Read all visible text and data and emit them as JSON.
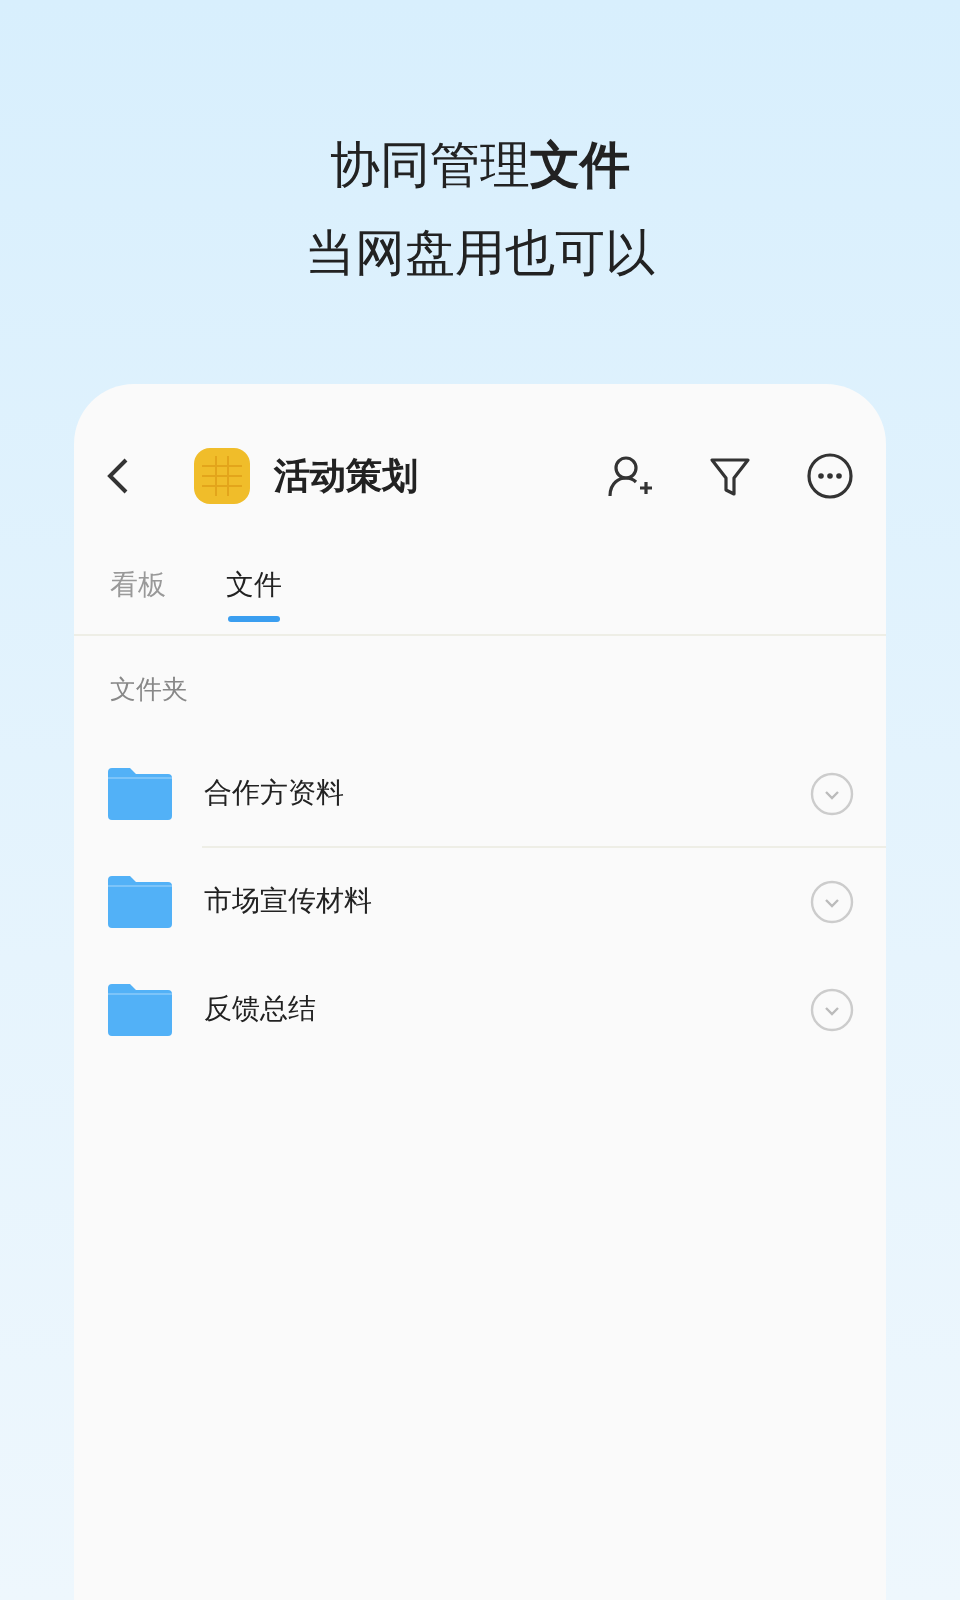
{
  "headline": {
    "line_1": "协同管理**文件**",
    "line_2": "当网盘用也可以"
  },
  "header": {
    "title": "活动策划"
  },
  "tabs": [
    {
      "label": "看板",
      "selected": false
    },
    {
      "label": "文件",
      "selected": true
    }
  ],
  "section_label": "文件夹",
  "folders": [
    {
      "name": "合作方资料",
      "divider": true
    },
    {
      "name": "市场宣传材料",
      "divider": false
    },
    {
      "name": "反馈总结",
      "divider": false
    }
  ]
}
